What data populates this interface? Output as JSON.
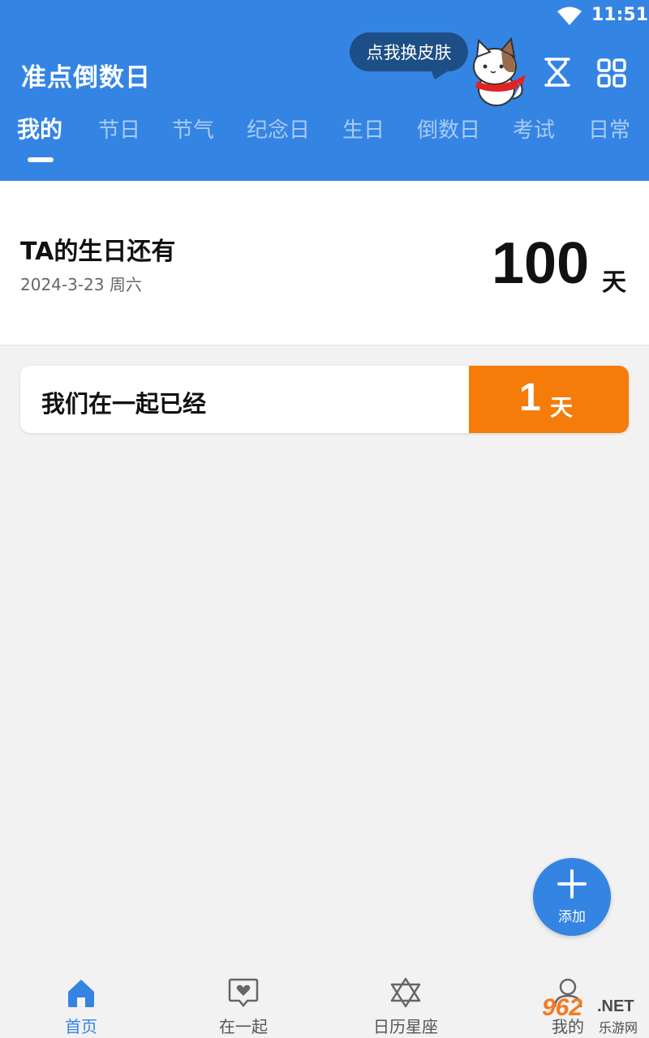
{
  "status_bar": {
    "time": "11:51"
  },
  "header": {
    "title": "准点倒数日",
    "skin_button": "点我换皮肤",
    "accent": "#3484e3"
  },
  "tabs": [
    {
      "label": "我的",
      "active": true
    },
    {
      "label": "节日"
    },
    {
      "label": "节气"
    },
    {
      "label": "纪念日"
    },
    {
      "label": "生日"
    },
    {
      "label": "倒数日"
    },
    {
      "label": "考试"
    },
    {
      "label": "日常"
    }
  ],
  "feature": {
    "title": "TA的生日还有",
    "date": "2024-3-23 周六",
    "count": "100",
    "unit": "天"
  },
  "events": [
    {
      "title": "我们在一起已经",
      "count": "1",
      "unit": "天",
      "color": "#f57c0a"
    }
  ],
  "fab": {
    "label": "添加"
  },
  "bottom_nav": [
    {
      "label": "首页",
      "icon": "home-icon",
      "active": true
    },
    {
      "label": "在一起",
      "icon": "heart-chat-icon"
    },
    {
      "label": "日历星座",
      "icon": "star-of-david-icon"
    },
    {
      "label": "我的",
      "icon": "person-icon"
    }
  ],
  "watermark": {
    "number": "962",
    "net": ".NET",
    "text": "乐游网"
  }
}
